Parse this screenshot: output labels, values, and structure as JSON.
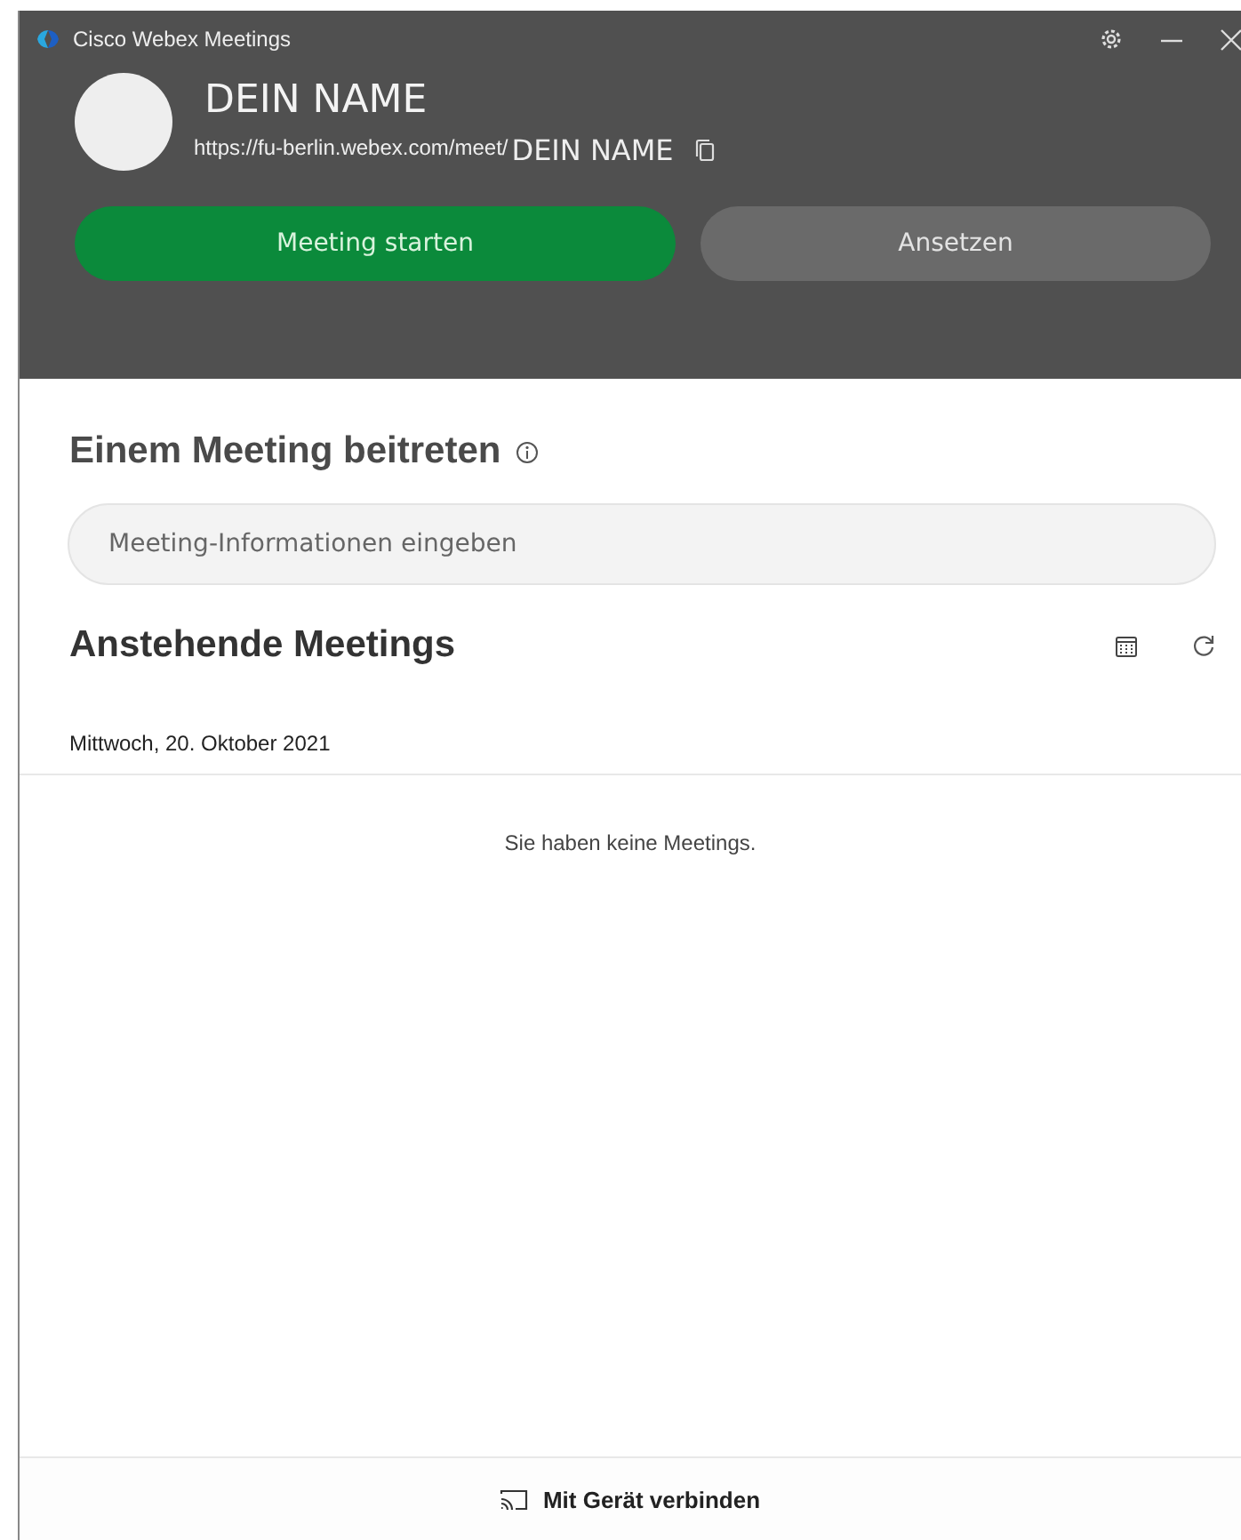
{
  "window": {
    "title": "Cisco Webex Meetings"
  },
  "profile": {
    "name": "DEIN NAME",
    "url_prefix": "https://fu-berlin.webex.com/meet/",
    "url_name": "DEIN NAME"
  },
  "actions": [
    {
      "label": "Meeting starten",
      "kind": "primary"
    },
    {
      "label": "Ansetzen",
      "kind": "secondary"
    }
  ],
  "join": {
    "title": "Einem Meeting beitreten",
    "placeholder": "Meeting-Informationen eingeben"
  },
  "upcoming": {
    "title": "Anstehende Meetings",
    "date": "Mittwoch, 20. Oktober 2021",
    "empty_message": "Sie haben keine Meetings."
  },
  "footer": {
    "label": "Mit Gerät verbinden"
  }
}
